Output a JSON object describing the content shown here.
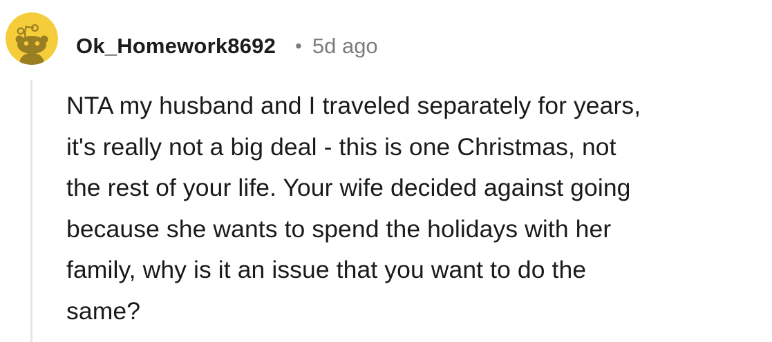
{
  "comment": {
    "username": "Ok_Homework8692",
    "separator": "•",
    "timestamp": "5d ago",
    "avatar_icon": "snoo-avatar-icon",
    "body_lines": [
      "NTA my husband and I traveled separately for years,",
      "it's really not a big deal - this is one Christmas, not",
      "the rest of your life. Your wife decided against going",
      "because she wants to spend the holidays with her",
      "family, why is it an issue that you want to do the",
      "same?"
    ]
  },
  "colors": {
    "avatar_background": "#F5CC3A",
    "avatar_figure": "#9A7E22",
    "thread_line": "#E4E6E8",
    "username_text": "#1C1C1C",
    "meta_text": "#7C7C7C",
    "body_text": "#1A1A1B"
  }
}
